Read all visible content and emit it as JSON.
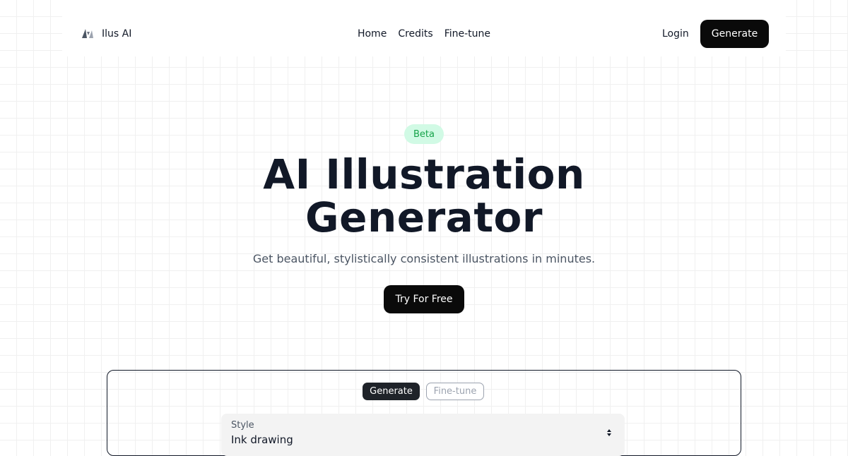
{
  "header": {
    "brand": "Ilus AI",
    "nav": [
      "Home",
      "Credits",
      "Fine-tune"
    ],
    "login": "Login",
    "generate": "Generate"
  },
  "hero": {
    "badge": "Beta",
    "title_line1": "AI Illustration",
    "title_line2": "Generator",
    "subtitle": "Get beautiful, stylistically consistent illustrations in minutes.",
    "cta": "Try For Free"
  },
  "panel": {
    "tabs": [
      "Generate",
      "Fine-tune"
    ],
    "active_tab": "Generate",
    "style_label": "Style",
    "style_value": "Ink drawing"
  },
  "colors": {
    "primary": "#0a0a0a",
    "badge_bg": "#d1fae5",
    "badge_text": "#16a34a"
  }
}
